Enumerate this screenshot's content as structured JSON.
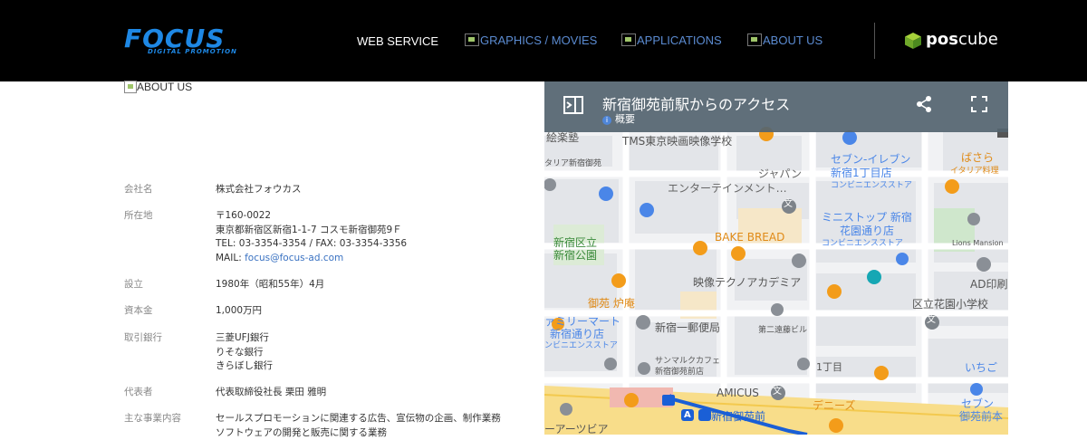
{
  "header": {
    "logo_text": "FOCUS",
    "logo_sub": "DIGITAL PROMOTION",
    "nav": [
      {
        "label": "WEB SERVICE"
      },
      {
        "label": "GRAPHICS / MOVIES"
      },
      {
        "label": "APPLICATIONS"
      },
      {
        "label": "ABOUT US"
      }
    ],
    "partner_pos": "pos",
    "partner_cube": "cube"
  },
  "about": {
    "heading": "ABOUT US",
    "rows": [
      {
        "label": "会社名",
        "lines": [
          "株式会社フォウカス"
        ]
      },
      {
        "label": "所在地",
        "lines": [
          "〒160-0022",
          "東京都新宿区新宿1-1-7 コスモ新宿御苑9Ｆ",
          "TEL: 03-3354-3354 / FAX: 03-3354-3356"
        ],
        "mail_prefix": "MAIL: ",
        "mail": "focus@focus-ad.com"
      },
      {
        "label": "設立",
        "lines": [
          "1980年（昭和55年）4月"
        ]
      },
      {
        "label": "資本金",
        "lines": [
          "1,000万円"
        ]
      },
      {
        "label": "取引銀行",
        "lines": [
          "三菱UFJ銀行",
          "りそな銀行",
          "きらぼし銀行"
        ]
      },
      {
        "label": "代表者",
        "lines": [
          "代表取締役社長 栗田 雅明"
        ]
      },
      {
        "label": "主な事業内容",
        "lines": [
          "セールスプロモーションに関連する広告、宣伝物の企画、制作業務",
          "ソフトウェアの開発と販売に関する業務"
        ]
      }
    ]
  },
  "map": {
    "title": "新宿御苑前駅からのアクセス",
    "subtitle": "概要",
    "info_glyph": "i",
    "labels": [
      "絵楽塾",
      "TMS東京映画映像学校",
      "タリア新宿御苑",
      "ジャパン",
      "エンターテインメント…",
      "セブン-イレブン",
      "新宿1丁目店",
      "コンビニエンスストア",
      "ばさら",
      "イタリア料理",
      "ミニストップ 新宿",
      "花園通り店",
      "コンビニエンスストア",
      "Lions Mansion",
      "新宿区立",
      "新宿公園",
      "BAKE BREAD",
      "AD印刷",
      "映像テクノアカデミア",
      "御苑 炉庵",
      "区立花園小学校",
      "ァミリーマート",
      "新宿通り店",
      "ンビニエンスストア",
      "新宿一郵便局",
      "第二遠藤ビル",
      "サンマルクカフェ",
      "新宿御苑前店",
      "1丁目",
      "いちご",
      "AMICUS",
      "デニーズ",
      "新宿御苑前",
      "セブン",
      "御苑前本",
      "ーアーツビア"
    ],
    "station_badge": "A",
    "culture_glyph": "文"
  }
}
